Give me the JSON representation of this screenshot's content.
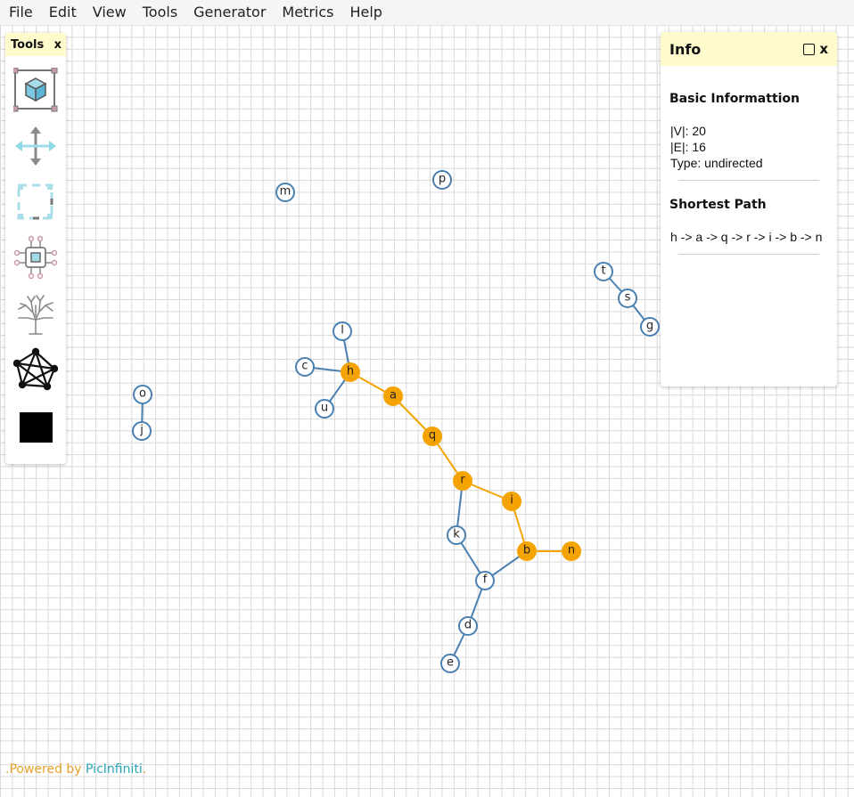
{
  "menu": [
    "File",
    "Edit",
    "View",
    "Tools",
    "Generator",
    "Metrics",
    "Help"
  ],
  "tools_panel": {
    "title": "Tools",
    "close": "x",
    "tools": [
      {
        "name": "vertex-tool-icon"
      },
      {
        "name": "move-tool-icon"
      },
      {
        "name": "select-tool-icon"
      },
      {
        "name": "component-tool-icon"
      },
      {
        "name": "tree-tool-icon"
      },
      {
        "name": "complete-graph-tool-icon"
      },
      {
        "name": "color-swatch-icon"
      }
    ]
  },
  "info_panel": {
    "title": "Info",
    "close": "x",
    "basic_title": "Basic Informattion",
    "vertices": "|V|: 20",
    "edges": "|E|: 16",
    "type": "Type: undirected",
    "path_title": "Shortest Path",
    "path": "h -> a -> q -> r -> i -> b -> n"
  },
  "footer": {
    "prefix": ".Powered by ",
    "brand": "PicInfiniti",
    "suffix": "."
  },
  "colors": {
    "node_stroke": "#4a80b0",
    "edge": "#4a80b0",
    "highlight": "#f5a300"
  },
  "graph": {
    "highlighted": [
      "h",
      "a",
      "q",
      "r",
      "i",
      "b",
      "n"
    ],
    "nodes": [
      "m",
      "p",
      "t",
      "s",
      "g",
      "l",
      "c",
      "h",
      "u",
      "a",
      "q",
      "o",
      "j",
      "r",
      "i",
      "k",
      "b",
      "n",
      "f",
      "d",
      "e"
    ],
    "edges": [
      [
        "t",
        "s"
      ],
      [
        "s",
        "g"
      ],
      [
        "l",
        "h"
      ],
      [
        "c",
        "h"
      ],
      [
        "h",
        "u"
      ],
      [
        "o",
        "j"
      ],
      [
        "h",
        "a"
      ],
      [
        "a",
        "q"
      ],
      [
        "q",
        "r"
      ],
      [
        "r",
        "i"
      ],
      [
        "i",
        "b"
      ],
      [
        "b",
        "n"
      ],
      [
        "r",
        "k"
      ],
      [
        "k",
        "f"
      ],
      [
        "b",
        "f"
      ],
      [
        "f",
        "d"
      ],
      [
        "d",
        "e"
      ]
    ]
  }
}
